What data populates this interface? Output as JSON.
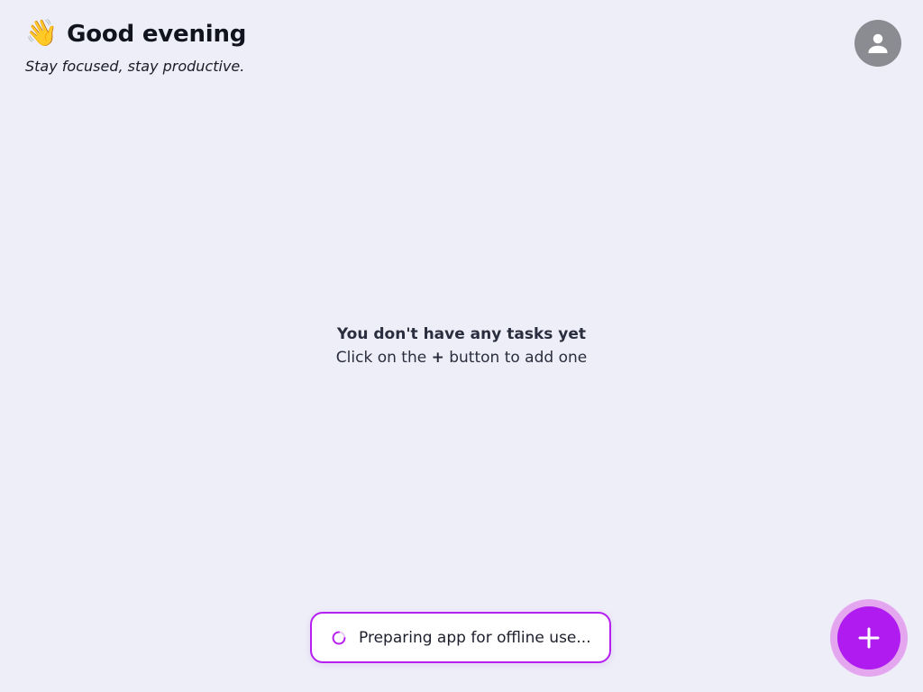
{
  "header": {
    "wave_emoji": "👋",
    "greeting": "Good evening",
    "subtitle": "Stay focused, stay productive."
  },
  "profile": {
    "icon": "user-avatar-icon",
    "color": "#8b8b92"
  },
  "empty_state": {
    "title": "You don't have any tasks yet",
    "hint_before": "Click on the ",
    "hint_symbol": "+",
    "hint_after": " button to add one"
  },
  "toast": {
    "message": "Preparing app for offline use...",
    "icon": "loading-spinner-icon",
    "border_color": "#b51ff0"
  },
  "fab": {
    "icon": "plus-icon",
    "color": "#b01cf0",
    "halo_color": "#e3a6ef"
  }
}
